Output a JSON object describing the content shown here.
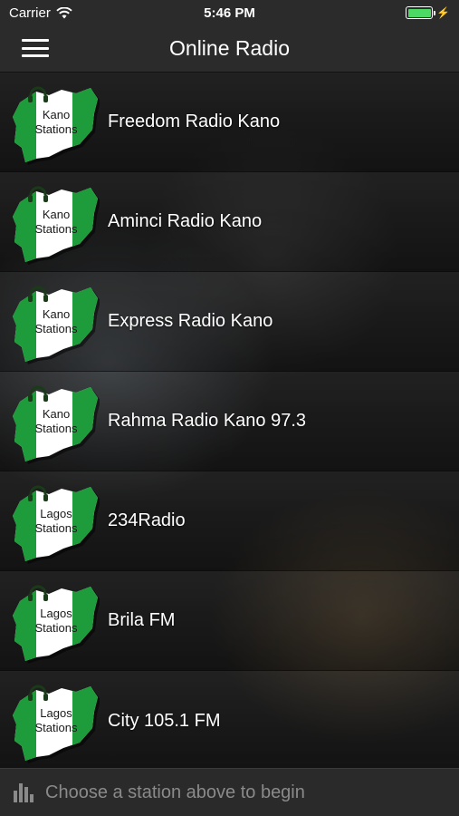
{
  "status": {
    "carrier": "Carrier",
    "time": "5:46 PM",
    "icons": [
      "wifi-icon",
      "battery-icon",
      "charging-bolt-icon"
    ]
  },
  "nav": {
    "title": "Online Radio",
    "menu_icon": "hamburger-menu-icon"
  },
  "stations": [
    {
      "name": "Freedom Radio Kano",
      "badge_line1": "Kano",
      "badge_line2": "Stations"
    },
    {
      "name": "Aminci Radio Kano",
      "badge_line1": "Kano",
      "badge_line2": "Stations"
    },
    {
      "name": "Express Radio Kano",
      "badge_line1": "Kano",
      "badge_line2": "Stations"
    },
    {
      "name": "Rahma Radio Kano 97.3",
      "badge_line1": "Kano",
      "badge_line2": "Stations"
    },
    {
      "name": "234Radio",
      "badge_line1": "Lagos",
      "badge_line2": "Stations"
    },
    {
      "name": "Brila FM",
      "badge_line1": "Lagos",
      "badge_line2": "Stations"
    },
    {
      "name": "City 105.1 FM",
      "badge_line1": "Lagos",
      "badge_line2": "Stations"
    }
  ],
  "player": {
    "message": "Choose a station above to begin",
    "icon": "equalizer-icon"
  },
  "colors": {
    "bar_bg": "#2b2b2b",
    "flag_green": "#1e9b3a",
    "flag_white": "#ffffff",
    "battery_green": "#4cd964"
  }
}
